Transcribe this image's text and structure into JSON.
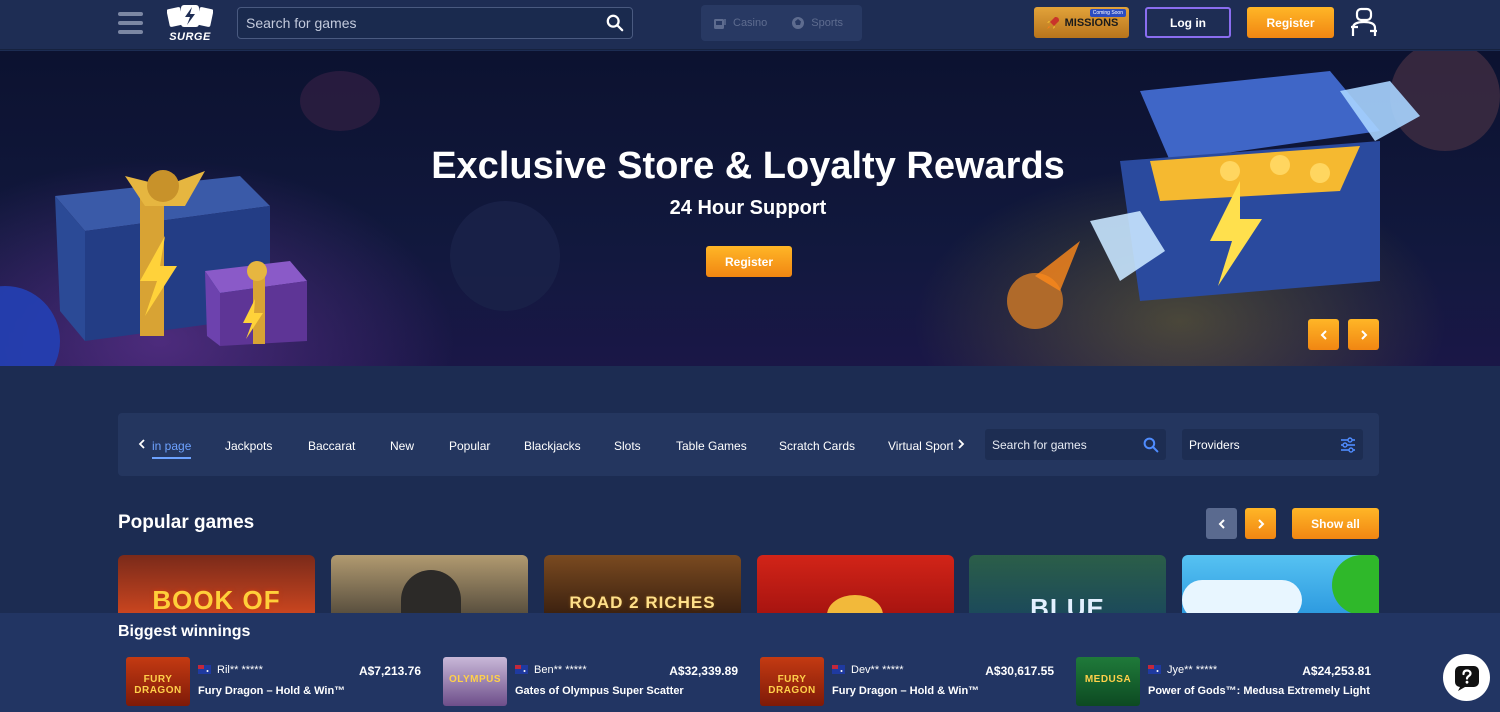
{
  "header": {
    "logo_text": "SURGE",
    "search_placeholder": "Search for games",
    "modes": [
      {
        "label": "Casino",
        "icon": "slot-machine-icon"
      },
      {
        "label": "Sports",
        "icon": "ball-icon"
      }
    ],
    "missions_label": "MISSIONS",
    "missions_badge": "Coming Soon",
    "login_label": "Log in",
    "register_label": "Register"
  },
  "hero": {
    "title": "Exclusive Store & Loyalty Rewards",
    "subtitle": "24 Hour Support",
    "register_label": "Register"
  },
  "categories": {
    "tabs": [
      {
        "label": "in page",
        "active": true
      },
      {
        "label": "Jackpots"
      },
      {
        "label": "Baccarat"
      },
      {
        "label": "New"
      },
      {
        "label": "Popular"
      },
      {
        "label": "Blackjacks"
      },
      {
        "label": "Slots"
      },
      {
        "label": "Table Games"
      },
      {
        "label": "Scratch Cards"
      },
      {
        "label": "Virtual Sport"
      }
    ],
    "search_placeholder": "Search for games",
    "providers_label": "Providers"
  },
  "popular_games": {
    "title": "Popular games",
    "show_all_label": "Show all",
    "cards": [
      {
        "label": "BOOK OF"
      },
      {
        "label": ""
      },
      {
        "label": "ROAD 2 RICHES"
      },
      {
        "label": ""
      },
      {
        "label": "BLUE"
      },
      {
        "label": ""
      }
    ]
  },
  "winnings": {
    "title": "Biggest winnings",
    "items": [
      {
        "user": "Ril** *****",
        "amount": "A$7,213.76",
        "game": "Fury Dragon – Hold & Win™",
        "thumb": "FURY DRAGON"
      },
      {
        "user": "Ben** *****",
        "amount": "A$32,339.89",
        "game": "Gates of Olympus Super Scatter",
        "thumb": "OLYMPUS"
      },
      {
        "user": "Dev** *****",
        "amount": "A$30,617.55",
        "game": "Fury Dragon – Hold & Win™",
        "thumb": "FURY DRAGON"
      },
      {
        "user": "Jye** *****",
        "amount": "A$24,253.81",
        "game": "Power of Gods™: Medusa Extremely Light",
        "thumb": "MEDUSA"
      }
    ]
  },
  "colors": {
    "accent_orange": "#f7a01f",
    "accent_purple": "#8a6df0",
    "active_tab": "#6da2ff",
    "background": "#1c2c52"
  }
}
